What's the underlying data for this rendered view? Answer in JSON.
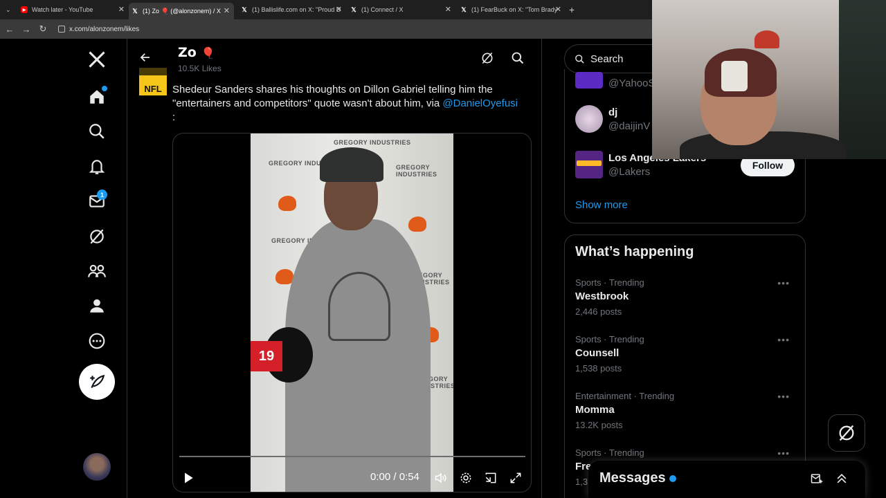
{
  "browser": {
    "tabs": [
      {
        "title": "Watch later - YouTube",
        "favicon": "youtube-icon"
      },
      {
        "title": "(1) Zo 🎈 (@alonzonem) / X",
        "favicon": "x-icon"
      },
      {
        "title": "(1) Ballislife.com on X: \"Proud D",
        "favicon": "x-icon"
      },
      {
        "title": "(1) Connect / X",
        "favicon": "x-icon"
      },
      {
        "title": "(1) FearBuck on X: \"Tom Brady",
        "favicon": "x-icon"
      }
    ],
    "url": "x.com/alonzonem/likes"
  },
  "nav": {
    "messages_badge": "1"
  },
  "header": {
    "name": "Zo",
    "likes": "10.5K Likes"
  },
  "tweet": {
    "avatar_text": "NFL",
    "text": "Shedeur Sanders shares his thoughts on Dillon Gabriel telling him the \"entertainers and competitors\" quote wasn't about him, via ",
    "mention": "@DanielOyefusi",
    "trailing": ":"
  },
  "video": {
    "time": "0:00 / 0:54",
    "progress": 0.0,
    "backdrop_text": "GREGORY INDUSTRIES",
    "mic_flag": "19"
  },
  "search": {
    "placeholder": "Search"
  },
  "who_to_follow": {
    "accounts": [
      {
        "name": "",
        "handle": "@YahooS"
      },
      {
        "name": "dj",
        "handle": "@daijinV"
      },
      {
        "name": "Los Angeles Lakers",
        "handle": "@Lakers"
      }
    ],
    "follow_label": "Follow",
    "show_more": "Show more"
  },
  "happening": {
    "title": "What’s happening",
    "trends": [
      {
        "meta": "Sports · Trending",
        "name": "Westbrook",
        "posts": "2,446 posts"
      },
      {
        "meta": "Sports · Trending",
        "name": "Counsell",
        "posts": "1,538 posts"
      },
      {
        "meta": "Entertainment · Trending",
        "name": "Momma",
        "posts": "13.2K posts"
      },
      {
        "meta": "Sports · Trending",
        "name": "Fre",
        "posts": "1,3"
      }
    ]
  },
  "messages": {
    "title": "Messages"
  },
  "colors": {
    "accent": "#1d9bf0",
    "background": "#000000",
    "border": "#2f3336",
    "muted": "#71767b"
  }
}
